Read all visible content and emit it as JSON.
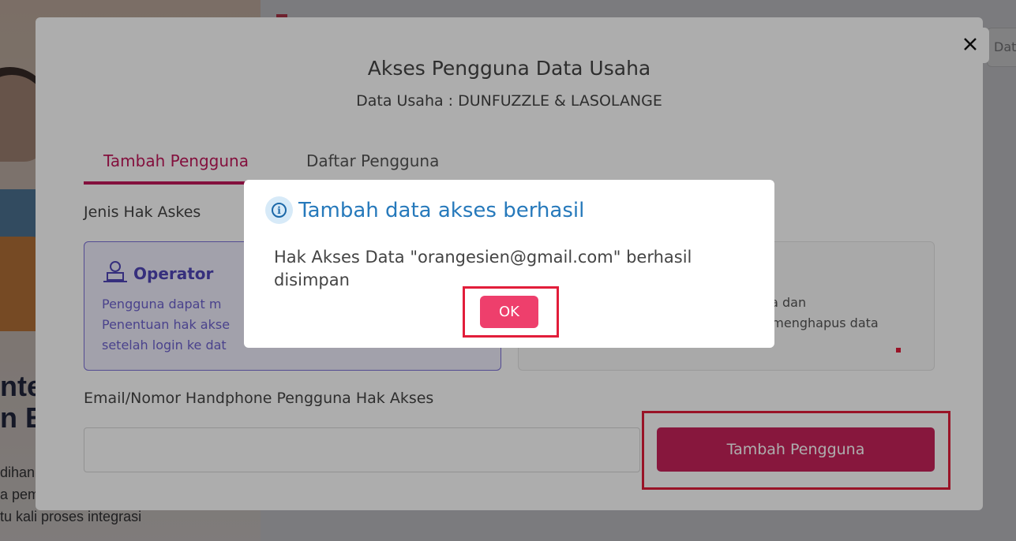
{
  "background": {
    "heading_partial": "ntec\nn E",
    "body_partial": "dihan\na pem\ntu kali proses integrasi",
    "right_button_partial": "Dat"
  },
  "modal": {
    "title": "Akses Pengguna Data Usaha",
    "subtitle": "Data Usaha : DUNFUZZLE & LASOLANGE",
    "close_icon": "close-icon",
    "tabs": [
      {
        "label": "Tambah Pengguna",
        "active": true
      },
      {
        "label": "Daftar Pengguna",
        "active": false
      }
    ],
    "access_type_label": "Jenis Hak Askes",
    "operator_card": {
      "title": "Operator",
      "description": "Pengguna dapat m\nPenentuan hak akse\nsetelah login ke dat",
      "icon": "user-icon"
    },
    "admin_card": {
      "description": "uka dan\na: menghapus data"
    },
    "email_label": "Email/Nomor Handphone Pengguna Hak Akses",
    "email_value": "",
    "add_button_label": "Tambah Pengguna"
  },
  "alert": {
    "icon": "info-icon",
    "title": "Tambah data akses berhasil",
    "message": "Hak Akses Data \"orangesien@gmail.com\" berhasil disimpan",
    "ok_label": "OK"
  },
  "colors": {
    "accent": "#c8225a",
    "operator_purple": "#5046b8",
    "alert_blue": "#2679bb",
    "highlight_red": "#e21d3a",
    "ok_button": "#ee3f6c"
  }
}
